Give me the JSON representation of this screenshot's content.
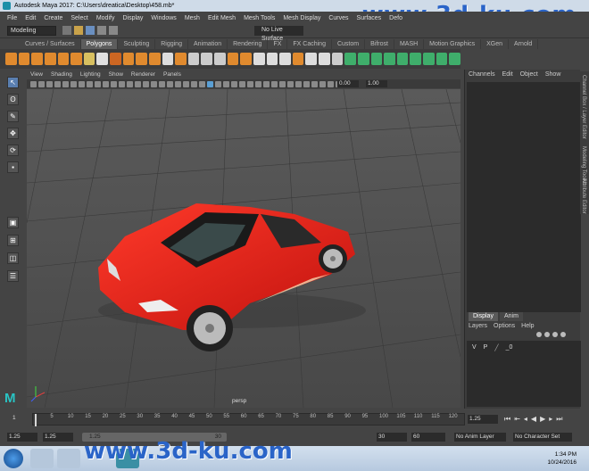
{
  "window": {
    "title": "Autodesk Maya 2017: C:\\Users\\dreatica\\Desktop\\458.mb*"
  },
  "watermark": {
    "text": "www.3d-ku.com"
  },
  "menu": [
    "File",
    "Edit",
    "Create",
    "Select",
    "Modify",
    "Display",
    "Windows",
    "Mesh",
    "Edit Mesh",
    "Mesh Tools",
    "Mesh Display",
    "Curves",
    "Surfaces",
    "Defo"
  ],
  "mode_dropdown": "Modeling",
  "live_surface": "No Live Surface",
  "shelf_tabs": [
    "Curves / Surfaces",
    "Polygons",
    "Sculpting",
    "Rigging",
    "Animation",
    "Rendering",
    "FX",
    "FX Caching",
    "Custom",
    "Bifrost",
    "MASH",
    "Motion Graphics",
    "XGen",
    "Arnold"
  ],
  "shelf_active": "Polygons",
  "viewport_menu": [
    "View",
    "Shading",
    "Lighting",
    "Show",
    "Renderer",
    "Panels"
  ],
  "viewport_fields": {
    "exposure": "0.00",
    "gamma": "1.00"
  },
  "viewport_label": "persp",
  "right_panel_menu": [
    "Channels",
    "Edit",
    "Object",
    "Show"
  ],
  "layer_tabs": [
    "Display",
    "Anim"
  ],
  "layer_active": "Display",
  "layer_menu": [
    "Layers",
    "Options",
    "Help"
  ],
  "layer_row": {
    "v": "V",
    "p": "P",
    "name": "_0"
  },
  "side_tabs": [
    "Channel Box / Layer Editor",
    "Modeling Toolkit",
    "Attribute Editor"
  ],
  "timeline_ticks": [
    "5",
    "10",
    "15",
    "20",
    "25",
    "30",
    "35",
    "40",
    "45",
    "50",
    "55",
    "60",
    "65",
    "70",
    "75",
    "80",
    "85",
    "90",
    "95",
    "100",
    "105",
    "110",
    "115",
    "120"
  ],
  "timeline_current": "1",
  "current_frame": "1.25",
  "range": {
    "start": "1.25",
    "start_inner": "1.25",
    "slider_start": "1.25",
    "slider_end": "30",
    "end_inner": "30",
    "end": "60"
  },
  "anim_layer": "No Anim Layer",
  "char_set": "No Character Set",
  "clock": {
    "time": "1:34 PM",
    "date": "10/24/2016"
  },
  "colors": {
    "car": "#e8201c",
    "accent": "#5a9fd4"
  }
}
